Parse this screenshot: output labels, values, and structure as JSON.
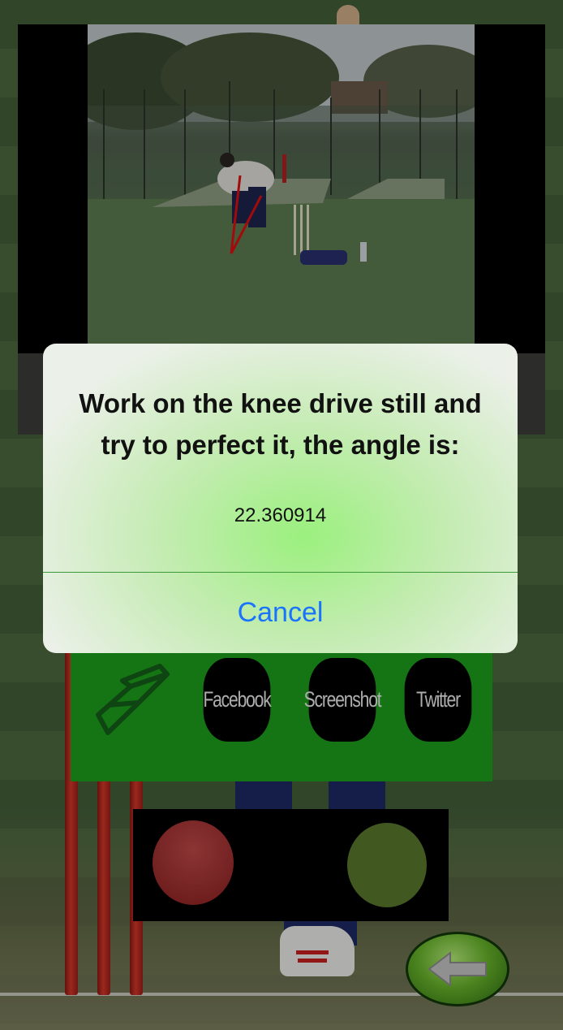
{
  "alert": {
    "title": "Work on the knee drive still and try to perfect it, the angle is:",
    "message": "22.360914",
    "cancel_label": "Cancel"
  },
  "toolbar": {
    "eraser_icon": "eraser-icon",
    "facebook_label": "Facebook",
    "screenshot_label": "Screenshot",
    "twitter_label": "Twitter"
  },
  "record_controls": {
    "left_color": "#b03030",
    "right_color": "#5b7a2e"
  },
  "back_button": {
    "icon": "arrow-left-icon"
  },
  "colors": {
    "toolbar_green": "#1ea11b",
    "angle_line": "#e01010",
    "cancel_blue": "#1a73ff"
  }
}
